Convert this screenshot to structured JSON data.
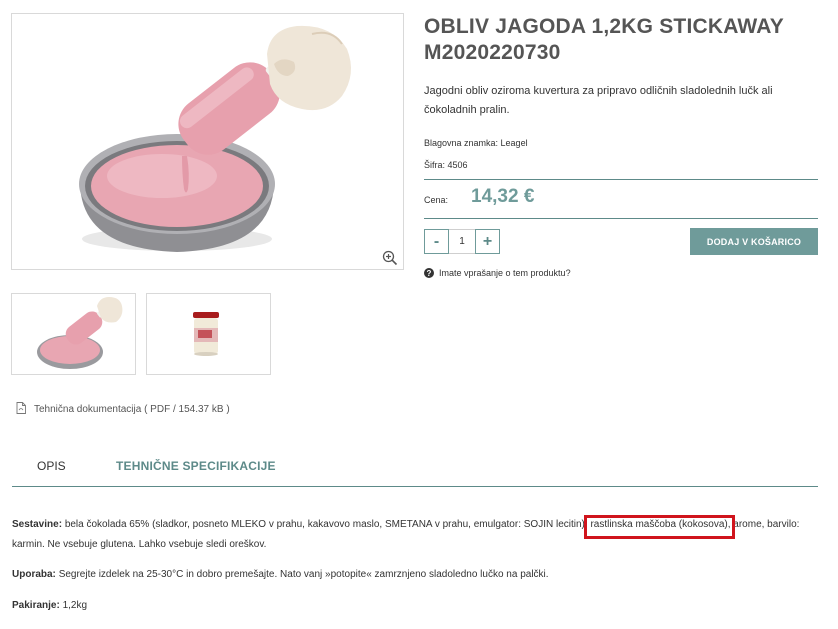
{
  "product": {
    "title": "OBLIV JAGODA 1,2KG STICKAWAY M2020220730",
    "description": "Jagodni obliv oziroma kuvertura za pripravo odličnih sladolednih lučk ali čokoladnih pralin.",
    "brand": "Blagovna znamka: Leagel",
    "sku": "Šifra: 4506",
    "price_label": "Cena:",
    "price": "14,32 €",
    "quantity": "1",
    "qty_minus": "-",
    "qty_plus": "+",
    "add_to_cart": "DODAJ V KOŠARICO",
    "question_link": "Imate vprašanje o tem produktu?"
  },
  "documentation": {
    "label": "Tehnična dokumentacija ( PDF / 154.37 kB )"
  },
  "tabs": [
    {
      "label": "OPIS",
      "active": false
    },
    {
      "label": "TEHNIČNE SPECIFIKACIJE",
      "active": true
    }
  ],
  "specs": {
    "ingredients_label": "Sestavine:",
    "ingredients_part1": "bela čokolada 65% (sladkor, posneto MLEKO v prahu, kakavovo maslo, SMETANA v prahu, emulgator: SOJIN lecitin),",
    "ingredients_highlight": "rastlinska maščoba (kokosova),",
    "ingredients_part2": "arome, barvilo: karmin. Ne vsebuje glutena. Lahko vsebuje sledi oreškov.",
    "usage_label": "Uporaba:",
    "usage_text": "Segrejte izdelek na 25-30°C in dobro premešajte. Nato vanj »potopite« zamrznjeno sladoledno lučko na palčki.",
    "packaging_label": "Pakiranje:",
    "packaging_text": "1,2kg"
  },
  "icons": {
    "zoom": "zoom-icon",
    "pdf": "pdf-file-icon",
    "question": "question-circle-icon"
  },
  "colors": {
    "accent": "#6f9b9a",
    "accent_dark": "#5d8a89",
    "highlight": "#d0141c"
  }
}
